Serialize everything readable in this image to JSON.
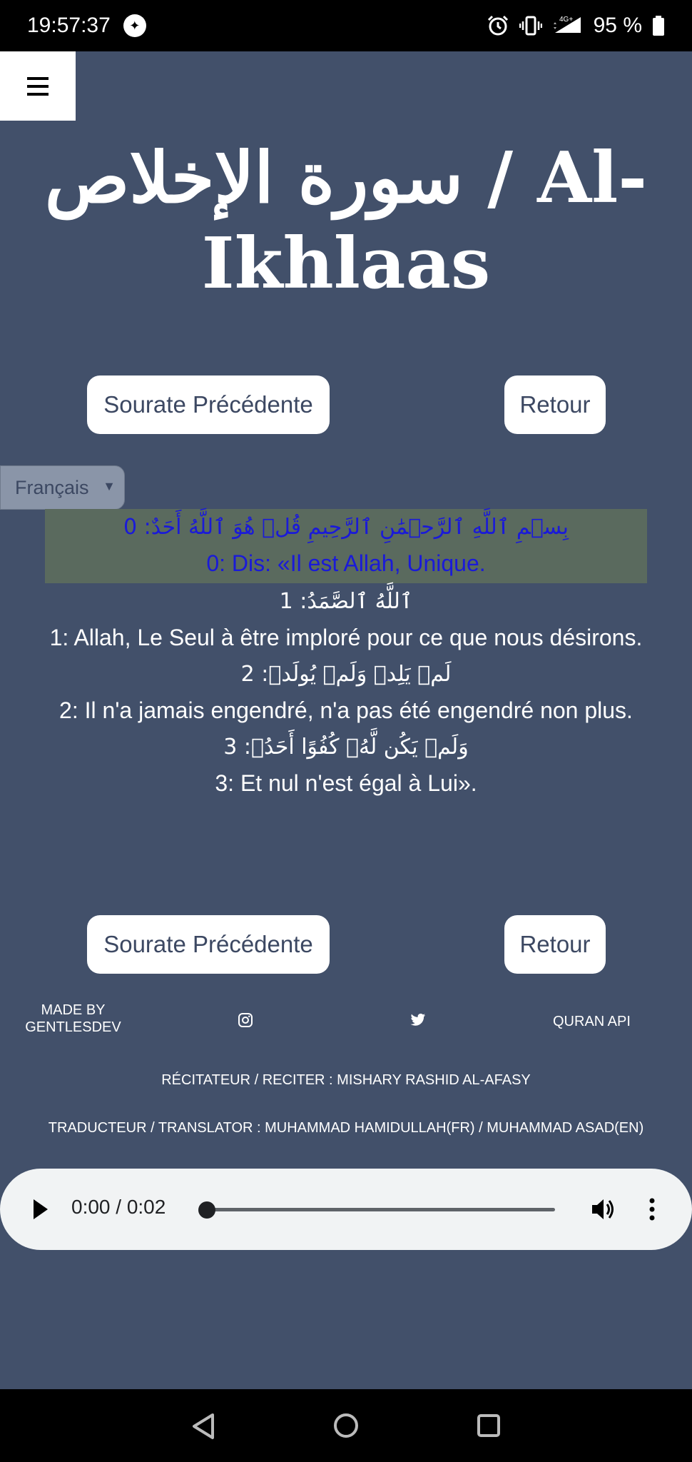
{
  "status_bar": {
    "time": "19:57:37",
    "network": "4G+",
    "battery": "95 %"
  },
  "header": {
    "menu_icon": "hamburger-icon",
    "title": "سورة الإخلاص / Al-Ikhlaas"
  },
  "navigation": {
    "prev_label": "Sourate Précédente",
    "back_label": "Retour"
  },
  "language": {
    "selected": "Français"
  },
  "verses": [
    {
      "arabic": "بِسۡمِ ٱللَّهِ ٱلرَّحۡمَٰنِ ٱلرَّحِيمِ قُلۡ هُوَ ٱللَّهُ أَحَدٌ: 0",
      "translation": "0: Dis: «Il est Allah, Unique.",
      "highlighted": true
    },
    {
      "arabic": "ٱللَّهُ ٱلصَّمَدُ: 1",
      "translation": "1: Allah, Le Seul à être imploré pour ce que nous désirons.",
      "highlighted": false
    },
    {
      "arabic": "لَمۡ يَلِدۡ وَلَمۡ يُولَدۡ: 2",
      "translation": "2: Il n'a jamais engendré, n'a pas été engendré non plus.",
      "highlighted": false
    },
    {
      "arabic": "وَلَمۡ يَكُن لَّهُۥ كُفُوًا أَحَدُۢ: 3",
      "translation": "3: Et nul n'est égal à Lui».",
      "highlighted": false
    }
  ],
  "footer": {
    "made_by": "MADE BY GENTLESDEV",
    "instagram_icon": "instagram-icon",
    "twitter_icon": "twitter-icon",
    "api_label": "QURAN API",
    "reciter": "RÉCITATEUR / RECITER : MISHARY RASHID AL-AFASY",
    "translator": "TRADUCTEUR / TRANSLATOR : MUHAMMAD HAMIDULLAH(FR) / MUHAMMAD ASAD(EN)"
  },
  "audio": {
    "time": "0:00 / 0:02",
    "progress": 0
  },
  "colors": {
    "background": "#42506a",
    "highlight_bg": "#5a6a5e",
    "highlight_text": "#1a1ad8",
    "button_text": "#3c4862"
  }
}
